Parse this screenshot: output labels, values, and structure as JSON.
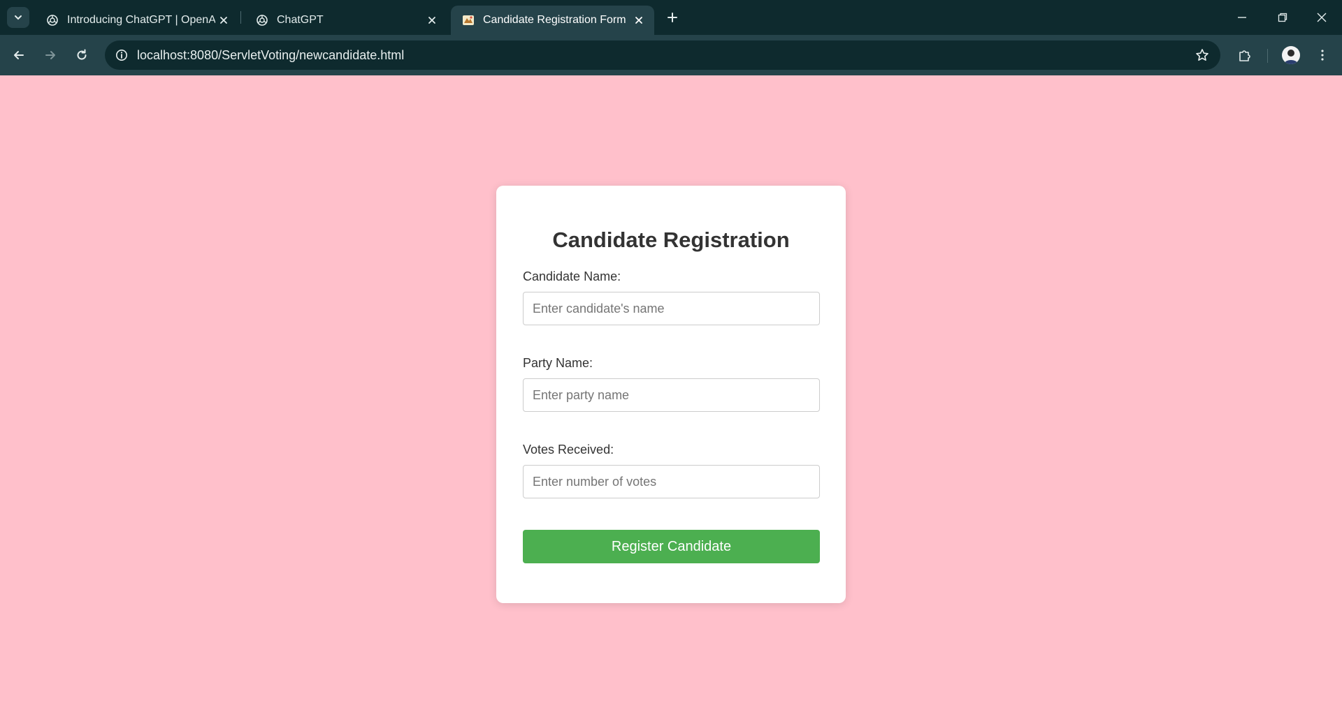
{
  "browser": {
    "tabs": [
      {
        "title": "Introducing ChatGPT | OpenAI",
        "favicon": "openai-logo-icon",
        "active": false
      },
      {
        "title": "ChatGPT",
        "favicon": "openai-logo-icon",
        "active": false
      },
      {
        "title": "Candidate Registration Form",
        "favicon": "page-favicon",
        "active": true
      }
    ],
    "url": "localhost:8080/ServletVoting/newcandidate.html",
    "colors": {
      "frame": "#0e2a2e",
      "toolbar": "#25434a"
    }
  },
  "page": {
    "background": "#ffc0cb",
    "form": {
      "heading": "Candidate Registration",
      "fields": [
        {
          "label": "Candidate Name:",
          "placeholder": "Enter candidate's name",
          "value": ""
        },
        {
          "label": "Party Name:",
          "placeholder": "Enter party name",
          "value": ""
        },
        {
          "label": "Votes Received:",
          "placeholder": "Enter number of votes",
          "value": ""
        }
      ],
      "submit_label": "Register Candidate",
      "submit_color": "#4caf50"
    }
  }
}
